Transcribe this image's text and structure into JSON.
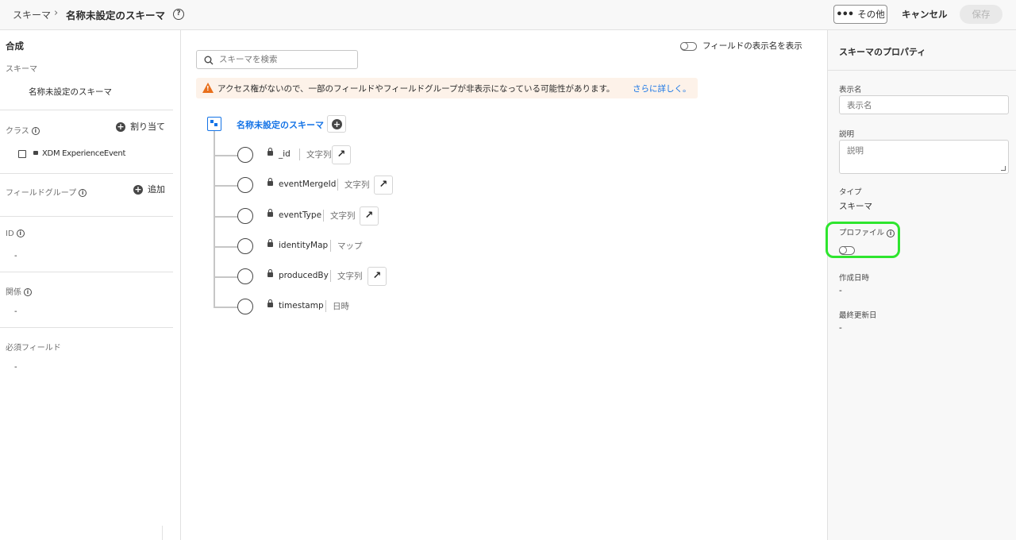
{
  "header": {
    "breadcrumb_root": "スキーマ",
    "breadcrumb_sep": "›",
    "title": "名称未設定のスキーマ",
    "help": "?",
    "more_label": "その他",
    "cancel_label": "キャンセル",
    "save_label": "保存"
  },
  "left_panel": {
    "title": "合成",
    "schema_label": "スキーマ",
    "schema_name": "名称未設定のスキーマ",
    "class_label": "クラス",
    "class_assign_label": "割り当て",
    "class_item": "XDM ExperienceEvent",
    "fieldgroup_label": "フィールドグループ",
    "fieldgroup_add_label": "追加",
    "id_label": "ID",
    "id_value": "-",
    "relation_label": "関係",
    "relation_value": "-",
    "required_label": "必須フィールド",
    "required_value": "-"
  },
  "center": {
    "search_placeholder": "スキーマを検索",
    "display_names_toggle_label": "フィールドの表示名を表示",
    "warning_text": "アクセス権がないので、一部のフィールドやフィールドグループが非表示になっている可能性があります。",
    "warning_link": "さらに詳しく。",
    "root_label": "名称未設定のスキーマ",
    "fields": [
      {
        "name": "_id",
        "type": "文字列",
        "has_link": true
      },
      {
        "name": "eventMergeId",
        "type": "文字列",
        "has_link": true
      },
      {
        "name": "eventType",
        "type": "文字列",
        "has_link": true
      },
      {
        "name": "identityMap",
        "type": "マップ",
        "has_link": false
      },
      {
        "name": "producedBy",
        "type": "文字列",
        "has_link": true
      },
      {
        "name": "timestamp",
        "type": "日時",
        "has_link": false
      }
    ]
  },
  "right_panel": {
    "title": "スキーマのプロパティ",
    "display_name_label": "表示名",
    "display_name_placeholder": "表示名",
    "description_label": "説明",
    "description_placeholder": "説明",
    "type_label": "タイプ",
    "type_value": "スキーマ",
    "profile_label": "プロファイル",
    "profile_enabled": false,
    "created_label": "作成日時",
    "created_value": "-",
    "modified_label": "最終更新日",
    "modified_value": "-"
  },
  "colors": {
    "accent": "#1473e6",
    "warning": "#e86f1c",
    "highlight": "#2ee52e"
  }
}
